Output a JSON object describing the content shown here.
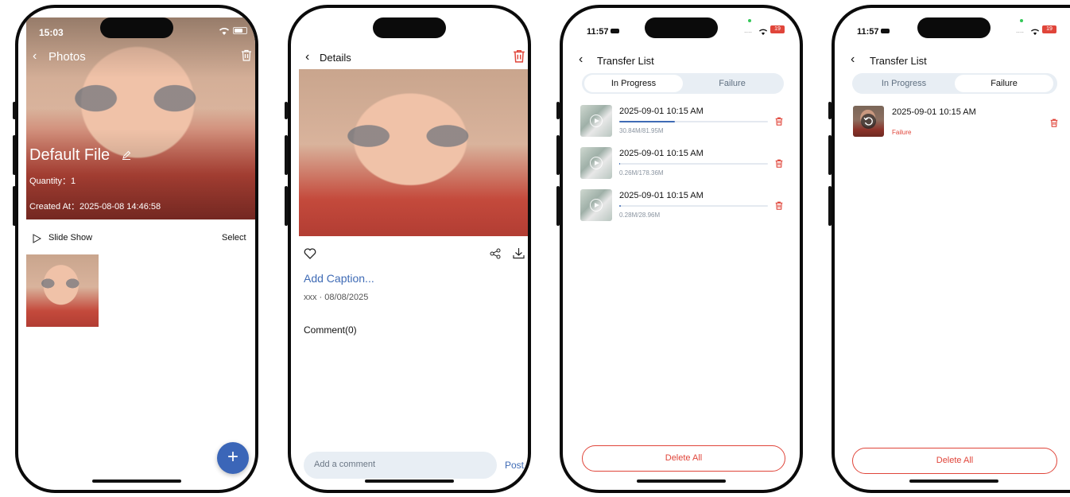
{
  "screen1": {
    "time": "15:03",
    "back_label": "Photos",
    "album_title": "Default File",
    "quantity": "Quantity：1",
    "created_at": "Created At：2025-08-08 14:46:58",
    "slide_show_label": "Slide Show",
    "select_label": "Select",
    "fab_label": "+"
  },
  "screen2": {
    "back_label": "Details",
    "caption": "Add Caption...",
    "meta": "xxx · 08/08/2025",
    "comments": "Comment(0)",
    "comment_placeholder": "Add a comment",
    "post_label": "Post"
  },
  "screen3": {
    "time": "11:57",
    "battery": "19",
    "title": "Transfer List",
    "tabs": [
      "In Progress",
      "Failure"
    ],
    "active_tab": "In Progress",
    "items": [
      {
        "date": "2025-09-01 10:15 AM",
        "size": "30.84M/81.95M",
        "progress": 0.376
      },
      {
        "date": "2025-09-01 10:15 AM",
        "size": "0.26M/178.36M",
        "progress": 0.0015
      },
      {
        "date": "2025-09-01 10:15 AM",
        "size": "0.28M/28.96M",
        "progress": 0.0097
      }
    ],
    "delete_all": "Delete All"
  },
  "screen4": {
    "time": "11:57",
    "battery": "19",
    "title": "Transfer List",
    "tabs": [
      "In Progress",
      "Failure"
    ],
    "active_tab": "Failure",
    "items": [
      {
        "date": "2025-09-01 10:15 AM",
        "status": "Failure"
      }
    ],
    "delete_all": "Delete All"
  },
  "colors": {
    "accent_blue": "#3f6bb5",
    "danger_red": "#e0453a",
    "segment_bg": "#e8eef4",
    "fab_blue": "#3b66b8"
  }
}
